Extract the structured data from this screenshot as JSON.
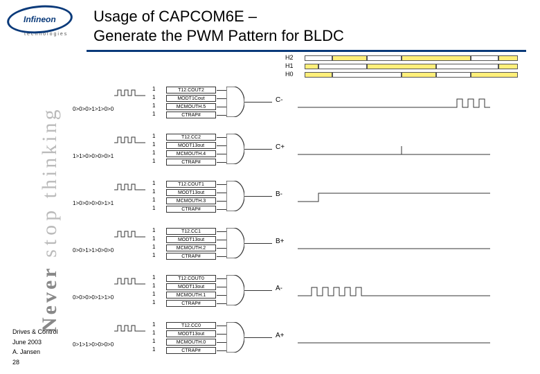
{
  "logo": {
    "name": "Infineon",
    "sub": "technologies"
  },
  "title": {
    "line1": "Usage of CAPCOM6E –",
    "line2": "Generate the PWM Pattern for BLDC"
  },
  "sidebar": {
    "never": "Never",
    "stop": "stop",
    "thinking": "thinking"
  },
  "top_bars": {
    "h2": "H2",
    "h1": "H1",
    "h0": "H0"
  },
  "blocks": [
    {
      "sigs": [
        "T12.COUT2",
        "MODT1Cout",
        "MCMOUTH.5",
        "CTRAP#"
      ],
      "ins": [
        "1",
        "1",
        "1",
        "1"
      ],
      "eq": "0>0>0>1>1>0>0",
      "out": "C-"
    },
    {
      "sigs": [
        "T12.CC2",
        "MODT13out",
        "MCMOUTH.4",
        "CTRAP#"
      ],
      "ins": [
        "1",
        "1",
        "1",
        "1"
      ],
      "eq": "1>1>0>0>0>0>1",
      "out": "C+"
    },
    {
      "sigs": [
        "T12.COUT1",
        "MODT13out",
        "MCMOUTH.3",
        "CTRAP#"
      ],
      "ins": [
        "1",
        "1",
        "1",
        "1"
      ],
      "eq": "1>0>0>0>0>1>1",
      "out": "B-"
    },
    {
      "sigs": [
        "T12.CC1",
        "MODT13out",
        "MCMOUTH.2",
        "CTRAP#"
      ],
      "ins": [
        "1",
        "1",
        "1",
        "1"
      ],
      "eq": "0>0>1>1>0>0>0",
      "out": "B+"
    },
    {
      "sigs": [
        "T12.COUT0",
        "MODT13out",
        "MCMOUTH.1",
        "CTRAP#"
      ],
      "ins": [
        "1",
        "1",
        "1",
        "1"
      ],
      "eq": "0>0>0>0>1>1>0",
      "out": "A-"
    },
    {
      "sigs": [
        "T12.CC0",
        "MODT13out",
        "MCMOUTH.0",
        "CTRAP#"
      ],
      "ins": [
        "1",
        "1",
        "1",
        "1"
      ],
      "eq": "0>1>1>0>0>0>0",
      "out": "A+"
    }
  ],
  "footer": {
    "dept": "Drives & Control",
    "date": "June 2003",
    "author": "A. Jansen",
    "page": "28"
  }
}
